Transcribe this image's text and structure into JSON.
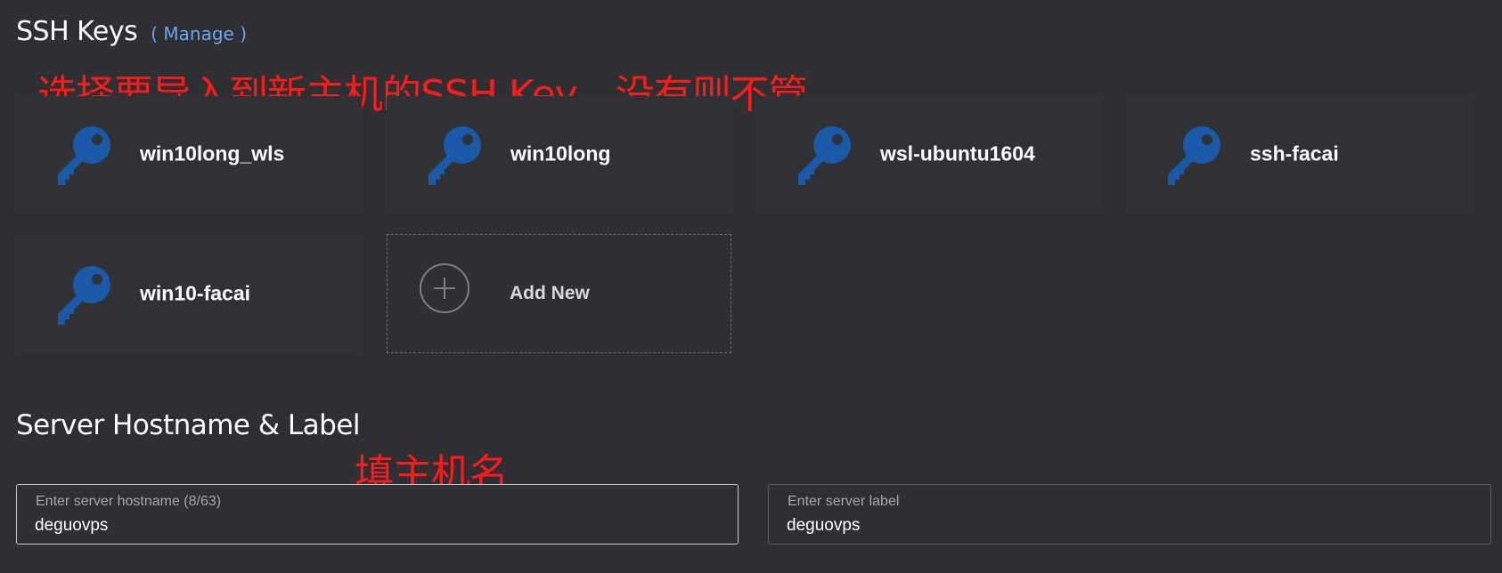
{
  "ssh_section": {
    "title": "SSH Keys",
    "manage_label": "( Manage )",
    "annotation": "选择要导入到新主机的SSH Key，没有则不管",
    "keys": [
      {
        "name": "win10long_wls",
        "icon": "key-icon"
      },
      {
        "name": "win10long",
        "icon": "key-icon"
      },
      {
        "name": "wsl-ubuntu1604",
        "icon": "key-icon"
      },
      {
        "name": "ssh-facai",
        "icon": "key-icon"
      },
      {
        "name": "win10-facai",
        "icon": "key-icon"
      }
    ],
    "add_new_label": "Add New"
  },
  "hostname_section": {
    "title": "Server Hostname & Label",
    "annotation": "填主机名",
    "hostname_field": {
      "label": "Enter server hostname (8/63)",
      "value": "deguovps"
    },
    "label_field": {
      "label": "Enter server label",
      "value": "deguovps"
    }
  },
  "colors": {
    "background": "#2e2f33",
    "card": "#303135",
    "key_icon": "#1a59a8",
    "manage_link": "#6aa5f2",
    "annotation": "#ff1a1a"
  }
}
